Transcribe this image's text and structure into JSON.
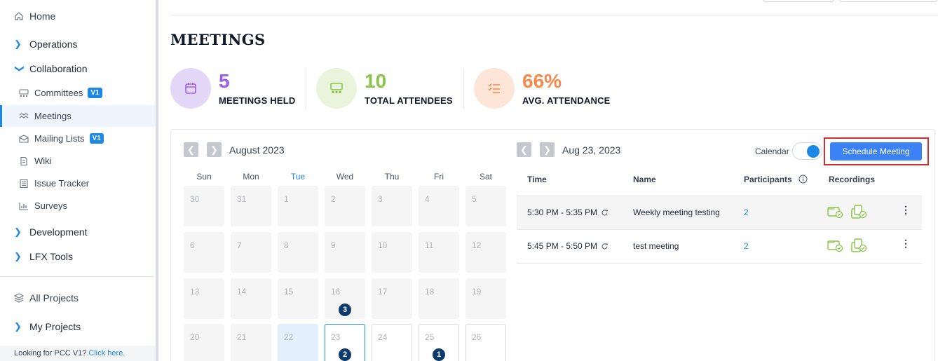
{
  "sidebar": {
    "home": "Home",
    "sections": {
      "operations": "Operations",
      "collaboration": "Collaboration",
      "development": "Development",
      "lfx_tools": "LFX Tools",
      "my_projects": "My Projects"
    },
    "collab_items": {
      "committees": "Committees",
      "meetings": "Meetings",
      "mailing_lists": "Mailing Lists",
      "wiki": "Wiki",
      "issue_tracker": "Issue Tracker",
      "surveys": "Surveys"
    },
    "badge": "V1",
    "all_projects": "All Projects",
    "footer_text": "Looking for PCC V1?",
    "footer_link": "Click here.",
    "active_item": "Meetings"
  },
  "page": {
    "title": "MEETINGS"
  },
  "stats": {
    "held": {
      "value": "5",
      "label": "MEETINGS HELD"
    },
    "attendees": {
      "value": "10",
      "label": "TOTAL ATTENDEES"
    },
    "attendance": {
      "value": "66%",
      "label": "AVG. ATTENDANCE"
    }
  },
  "calendar": {
    "month": "August 2023",
    "days_of_week": [
      "Sun",
      "Mon",
      "Tue",
      "Wed",
      "Thu",
      "Fri",
      "Sat"
    ],
    "weeks": [
      [
        "30",
        "31",
        "1",
        "2",
        "3",
        "4",
        "5"
      ],
      [
        "6",
        "7",
        "8",
        "9",
        "10",
        "11",
        "12"
      ],
      [
        "13",
        "14",
        "15",
        "16",
        "17",
        "18",
        "19"
      ],
      [
        "20",
        "21",
        "22",
        "23",
        "24",
        "25",
        "26"
      ]
    ],
    "counts": {
      "16": "3",
      "23": "2",
      "25": "1"
    }
  },
  "day_panel": {
    "date": "Aug 23, 2023",
    "view_toggle_label": "Calendar",
    "schedule_button": "Schedule Meeting",
    "columns": {
      "time": "Time",
      "name": "Name",
      "participants": "Participants",
      "recordings": "Recordings"
    },
    "rows": [
      {
        "time": "5:30 PM - 5:35 PM",
        "name": "Weekly meeting testing",
        "participants": "2"
      },
      {
        "time": "5:45 PM - 5:50 PM",
        "name": "test meeting",
        "participants": "2"
      }
    ]
  },
  "colors": {
    "accent": "#1e88e5",
    "meetings_held": "#9b5de5",
    "total_attendees": "#8bc34a",
    "avg_attendance": "#f4894b",
    "highlight_box": "#d32f2f"
  }
}
